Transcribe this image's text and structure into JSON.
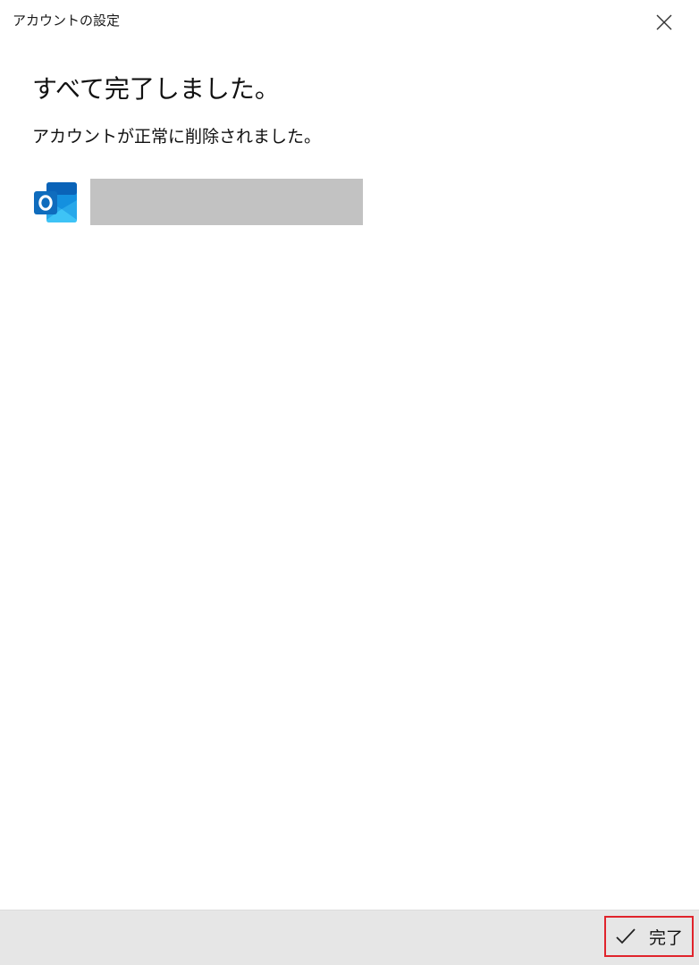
{
  "window": {
    "title": "アカウントの設定"
  },
  "main": {
    "heading": "すべて完了しました。",
    "message": "アカウントが正常に削除されました。",
    "account": {
      "icon": "outlook-icon",
      "name_redacted": true
    }
  },
  "footer": {
    "done_label": "完了",
    "done_icon": "checkmark-icon"
  },
  "colors": {
    "highlight_border": "#e0242c",
    "footer_bg": "#e6e6e6",
    "redaction": "#c2c2c2",
    "outlook_blue": "#0f6cbd"
  }
}
